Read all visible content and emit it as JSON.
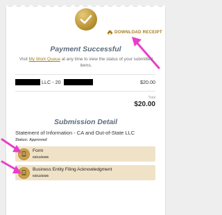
{
  "header": {
    "download_receipt_label": "DOWNLOAD RECEIPT"
  },
  "payment": {
    "title": "Payment Successful",
    "visit_prefix": "Visit ",
    "visit_link": "My Work Queue",
    "visit_suffix": " at any time to view the status of your submitted items."
  },
  "line_item": {
    "name_visible": "LLC - 20",
    "price": "$20.00"
  },
  "total": {
    "label": "Total",
    "value": "$20.00"
  },
  "submission": {
    "title": "Submission Detail",
    "filing_name": "Statement of Information - CA and Out-of-State LLC",
    "status": "Status: Approved",
    "documents": [
      {
        "name": "Form",
        "date": "03/12/2025"
      },
      {
        "name": "Business Entity Filing Acknowledgment",
        "date": "03/12/2025"
      }
    ]
  },
  "colors": {
    "accent": "#a67c1c",
    "heading": "#5c6b7b",
    "doc_bg": "#f0e2c6",
    "annotation_arrow": "#e83fc8"
  }
}
